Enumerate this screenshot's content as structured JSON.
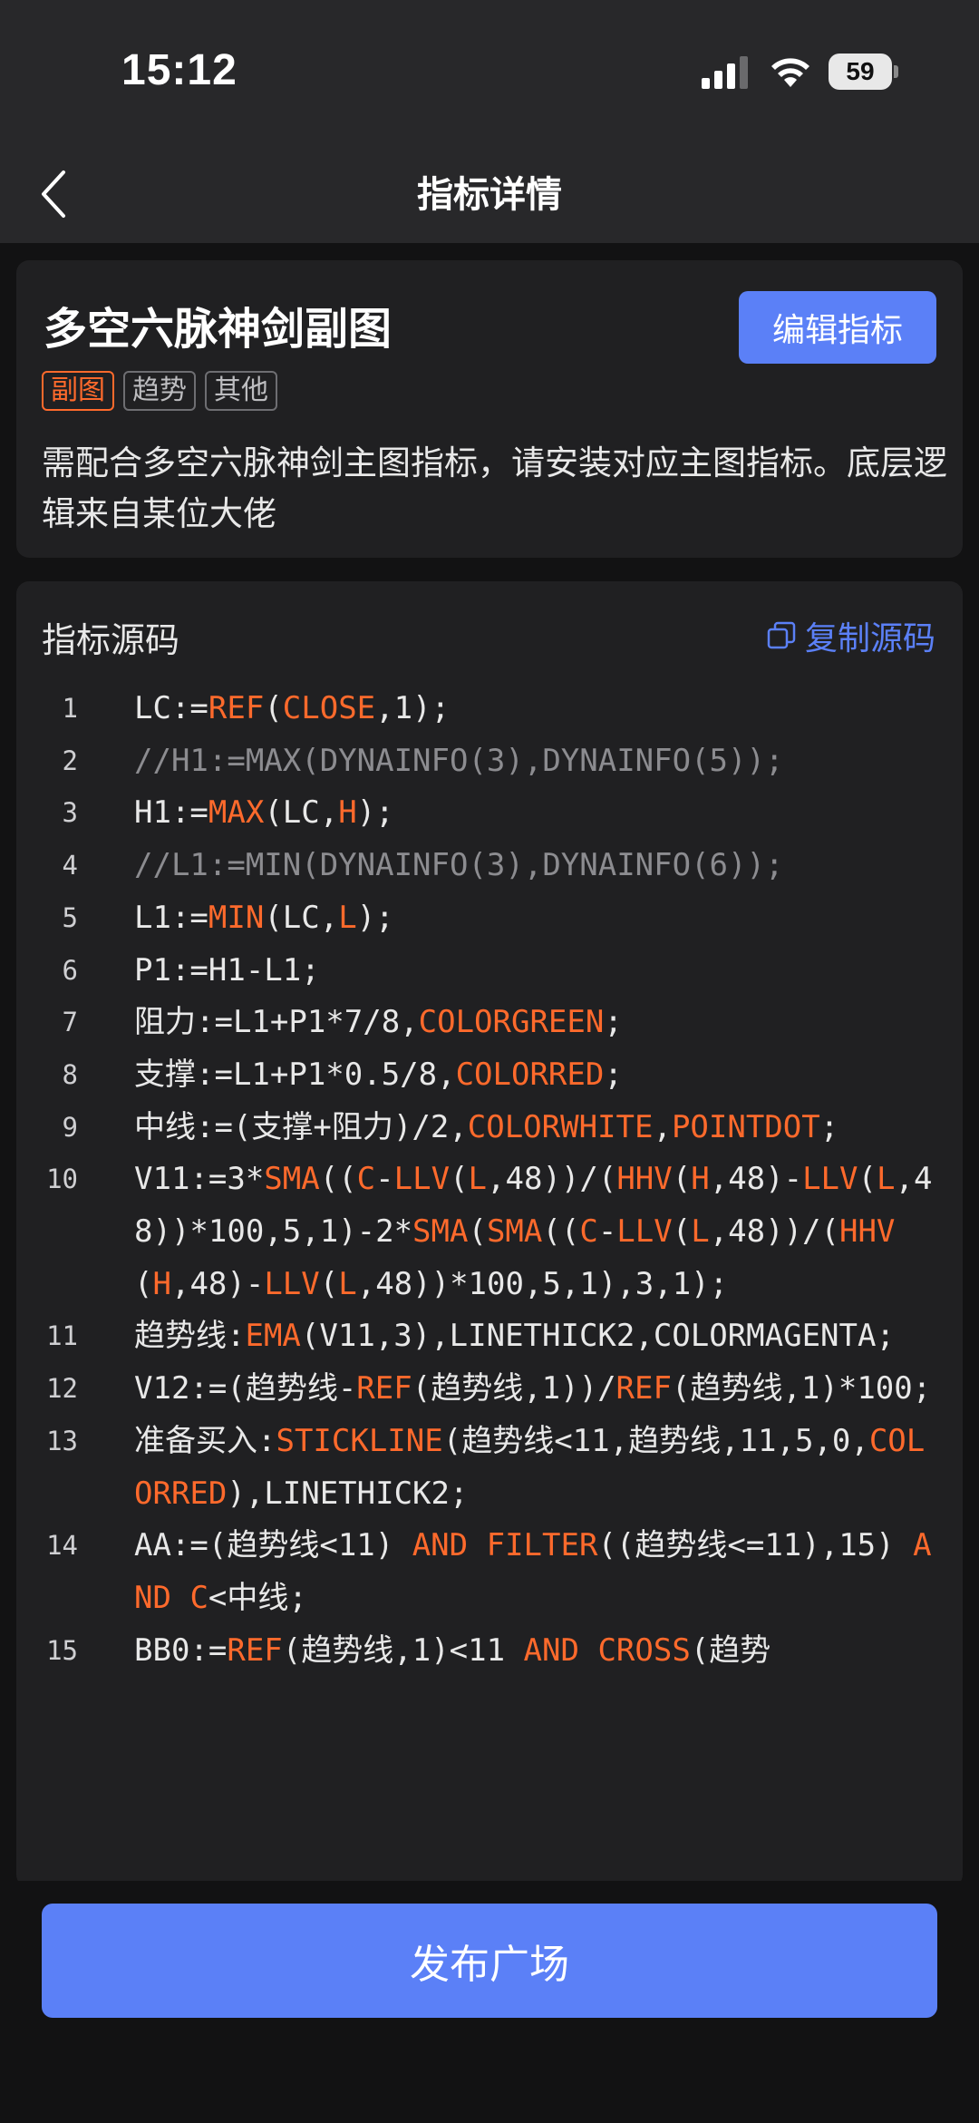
{
  "status_bar": {
    "time": "15:12",
    "battery": "59"
  },
  "nav": {
    "title": "指标详情"
  },
  "indicator": {
    "title": "多空六脉神剑副图",
    "edit_label": "编辑指标",
    "tags": [
      "副图",
      "趋势",
      "其他"
    ],
    "description": "需配合多空六脉神剑主图指标，请安装对应主图指标。底层逻辑来自某位大佬"
  },
  "source": {
    "label": "指标源码",
    "copy_label": "复制源码",
    "lines": [
      {
        "no": "1",
        "text": "LC:=REF(CLOSE,1);"
      },
      {
        "no": "2",
        "text": "//H1:=MAX(DYNAINFO(3),DYNAINFO(5));"
      },
      {
        "no": "3",
        "text": "H1:=MAX(LC,H);"
      },
      {
        "no": "4",
        "text": "//L1:=MIN(DYNAINFO(3),DYNAINFO(6));"
      },
      {
        "no": "5",
        "text": "L1:=MIN(LC,L);"
      },
      {
        "no": "6",
        "text": "P1:=H1-L1;"
      },
      {
        "no": "7",
        "text": "阻力:=L1+P1*7/8,COLORGREEN;"
      },
      {
        "no": "8",
        "text": "支撑:=L1+P1*0.5/8,COLORRED;"
      },
      {
        "no": "9",
        "text": "中线:=(支撑+阻力)/2,COLORWHITE,POINTDOT;"
      },
      {
        "no": "10",
        "text": "V11:=3*SMA((C-LLV(L,48))/(HHV(H,48)-LLV(L,48))*100,5,1)-2*SMA(SMA((C-LLV(L,48))/(HHV(H,48)-LLV(L,48))*100,5,1),3,1);"
      },
      {
        "no": "11",
        "text": "趋势线:EMA(V11,3),LINETHICK2,COLORMAGENTA;"
      },
      {
        "no": "12",
        "text": "V12:=(趋势线-REF(趋势线,1))/REF(趋势线,1)*100;"
      },
      {
        "no": "13",
        "text": "准备买入:STICKLINE(趋势线<11,趋势线,11,5,0,COLORRED),LINETHICK2;"
      },
      {
        "no": "14",
        "text": "AA:=(趋势线<11) AND FILTER((趋势线<=11),15) AND C<中线;"
      },
      {
        "no": "15",
        "text": "BB0:=REF(趋势线,1)<11 AND CROSS(趋势"
      }
    ]
  },
  "footer": {
    "publish_label": "发布广场"
  },
  "colors": {
    "accent": "#5b80f7",
    "keyword": "#ff6a2c",
    "comment": "#8c8c90"
  },
  "icons": [
    "signal-icon",
    "wifi-icon",
    "battery-icon",
    "back-icon",
    "copy-icon"
  ]
}
